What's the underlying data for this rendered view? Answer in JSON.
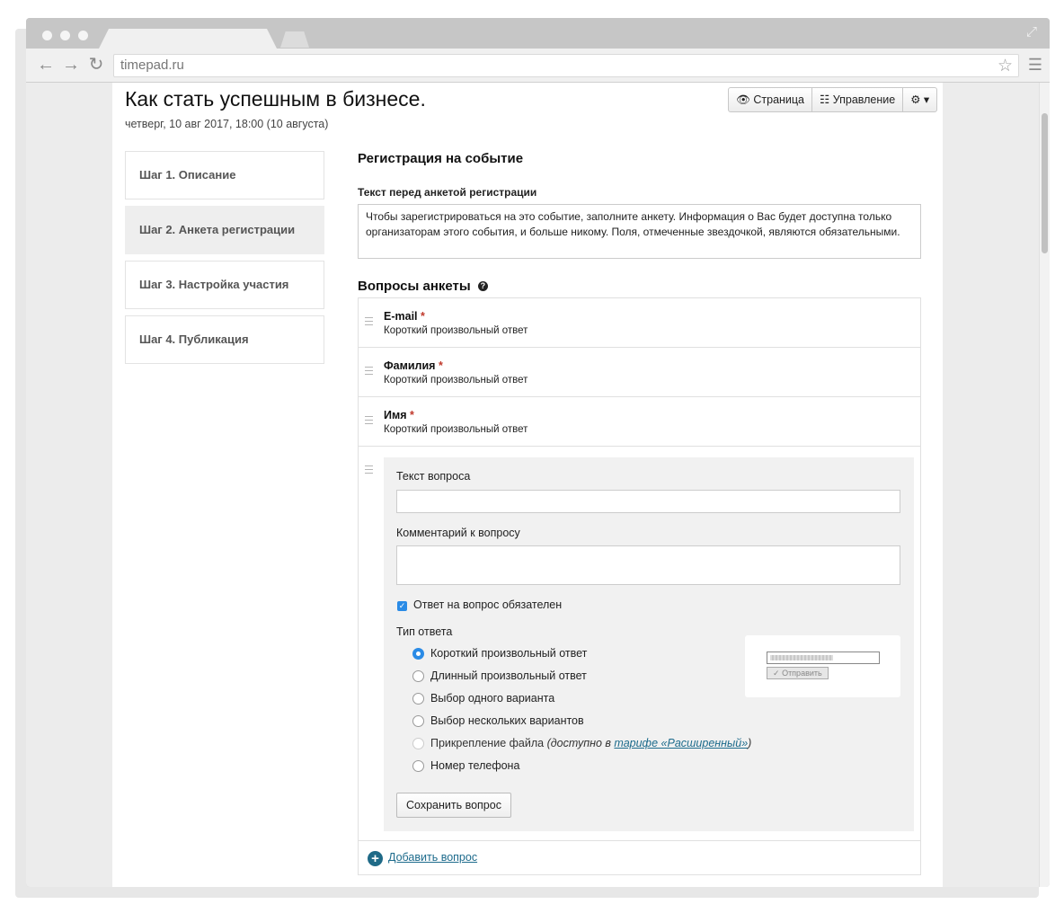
{
  "browser": {
    "url": "timepad.ru"
  },
  "header": {
    "title": "Как стать успешным в бизнесе.",
    "date": "четверг, 10 авг 2017, 18:00 (10 августа)",
    "buttons": {
      "page": "Страница",
      "manage": "Управление"
    }
  },
  "steps": [
    {
      "label": "Шаг 1. Описание",
      "active": false
    },
    {
      "label": "Шаг 2. Анкета регистрации",
      "active": true
    },
    {
      "label": "Шаг 3. Настройка участия",
      "active": false
    },
    {
      "label": "Шаг 4. Публикация",
      "active": false
    }
  ],
  "registration": {
    "heading": "Регистрация на событие",
    "before_label": "Текст перед анкетой регистрации",
    "before_text": "Чтобы зарегистрироваться на это событие, заполните анкету. Информация о Вас будет доступна только организаторам этого события, и больше никому. Поля, отмеченные звездочкой, являются обязательными.",
    "questions_heading": "Вопросы анкеты"
  },
  "questions": [
    {
      "name": "E-mail",
      "required_mark": "*",
      "type": "Короткий произвольный ответ"
    },
    {
      "name": "Фамилия",
      "required_mark": "*",
      "type": "Короткий произвольный ответ"
    },
    {
      "name": "Имя",
      "required_mark": "*",
      "type": "Короткий произвольный ответ"
    }
  ],
  "editor": {
    "question_text_label": "Текст вопроса",
    "question_text_value": "",
    "comment_label": "Комментарий к вопросу",
    "comment_value": "",
    "required_label": "Ответ на вопрос обязателен",
    "required_checked": true,
    "answer_type_label": "Тип ответа",
    "answer_types": [
      {
        "label": "Короткий произвольный ответ",
        "selected": true
      },
      {
        "label": "Длинный произвольный ответ",
        "selected": false
      },
      {
        "label": "Выбор одного варианта",
        "selected": false
      },
      {
        "label": "Выбор нескольких вариантов",
        "selected": false
      },
      {
        "label": "Прикрепление файла",
        "note_prefix": "(доступно в ",
        "note_link": "тарифе «Расширенный»",
        "note_suffix": ")",
        "disabled": true
      },
      {
        "label": "Номер телефона",
        "selected": false
      }
    ],
    "preview_button": "Отправить",
    "save_button": "Сохранить вопрос"
  },
  "add_question": "Добавить вопрос",
  "colors": {
    "accent": "#2a8be6",
    "link": "#1d6b8c",
    "required": "#c0392b"
  }
}
